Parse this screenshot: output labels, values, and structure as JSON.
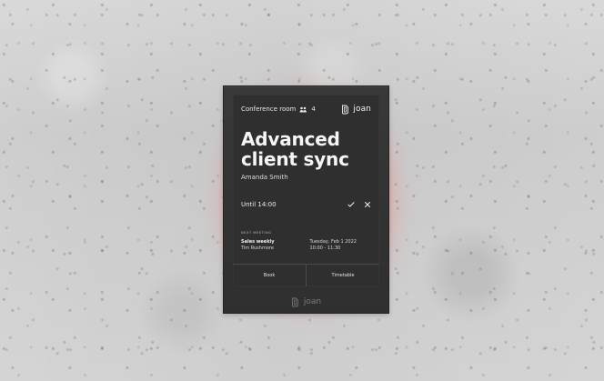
{
  "device": {
    "brand": "joan",
    "bottom_brand": "joan",
    "accent_glow_color": "#ff5a5a",
    "screen_color": "#2f2f2f",
    "frame_color": "#343434"
  },
  "header": {
    "room_name": "Conference room",
    "capacity": "4",
    "people_icon": "people-icon",
    "brand_logo_icon": "joan-logo-icon"
  },
  "meeting": {
    "title_line_1": "Advanced",
    "title_line_2": "client sync",
    "organizer": "Amanda Smith",
    "until": "Until 14:00",
    "accept_icon": "check-icon",
    "decline_icon": "close-icon"
  },
  "next_meeting": {
    "label": "NEXT MEETING",
    "title": "Sales weekly",
    "host": "Tim Rushmore",
    "date": "Tuesday, Feb 1 2022",
    "time": "10:00 - 11:30"
  },
  "footer": {
    "book_label": "Book",
    "timetable_label": "Timetable"
  }
}
